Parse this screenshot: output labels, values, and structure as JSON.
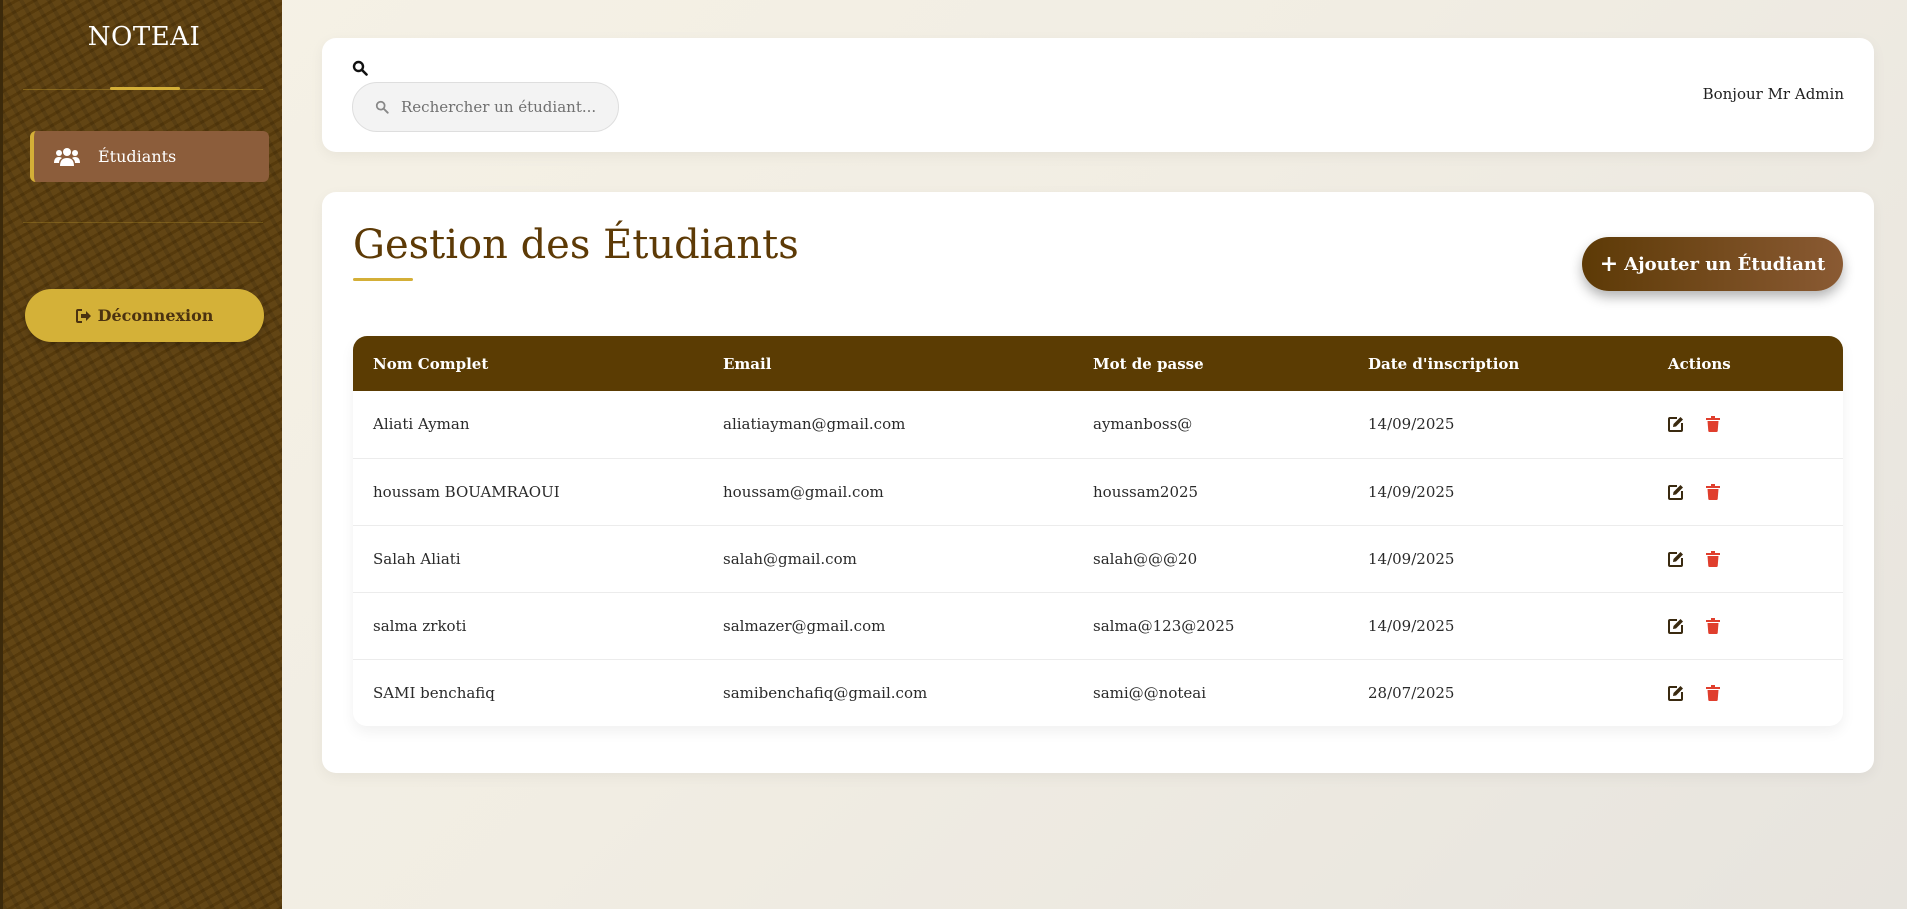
{
  "app": {
    "brand": "NOTEAI"
  },
  "sidebar": {
    "items": [
      {
        "label": "Étudiants",
        "icon": "users-icon",
        "active": true
      }
    ],
    "logout_label": "Déconnexion"
  },
  "header": {
    "search_placeholder": "Rechercher un étudiant...",
    "greeting": "Bonjour Mr Admin"
  },
  "main": {
    "title": "Gestion des Étudiants",
    "add_button_label": "Ajouter un Étudiant",
    "table": {
      "headers": [
        "Nom Complet",
        "Email",
        "Mot de passe",
        "Date d'inscription",
        "Actions"
      ],
      "rows": [
        {
          "name": "Aliati Ayman",
          "email": "aliatiayman@gmail.com",
          "password": "aymanboss@",
          "date": "14/09/2025"
        },
        {
          "name": "houssam BOUAMRAOUI",
          "email": "houssam@gmail.com",
          "password": "houssam2025",
          "date": "14/09/2025"
        },
        {
          "name": "Salah Aliati",
          "email": "salah@gmail.com",
          "password": "salah@@@20",
          "date": "14/09/2025"
        },
        {
          "name": "salma zrkoti",
          "email": "salmazer@gmail.com",
          "password": "salma@123@2025",
          "date": "14/09/2025"
        },
        {
          "name": "SAMI benchafiq",
          "email": "samibenchafiq@gmail.com",
          "password": "sami@@noteai",
          "date": "28/07/2025"
        }
      ]
    }
  },
  "colors": {
    "sidebar_bg": "#5d3f0d",
    "accent_gold": "#d4af37",
    "header_brown": "#5b3c03",
    "delete_red": "#e03e2d"
  }
}
